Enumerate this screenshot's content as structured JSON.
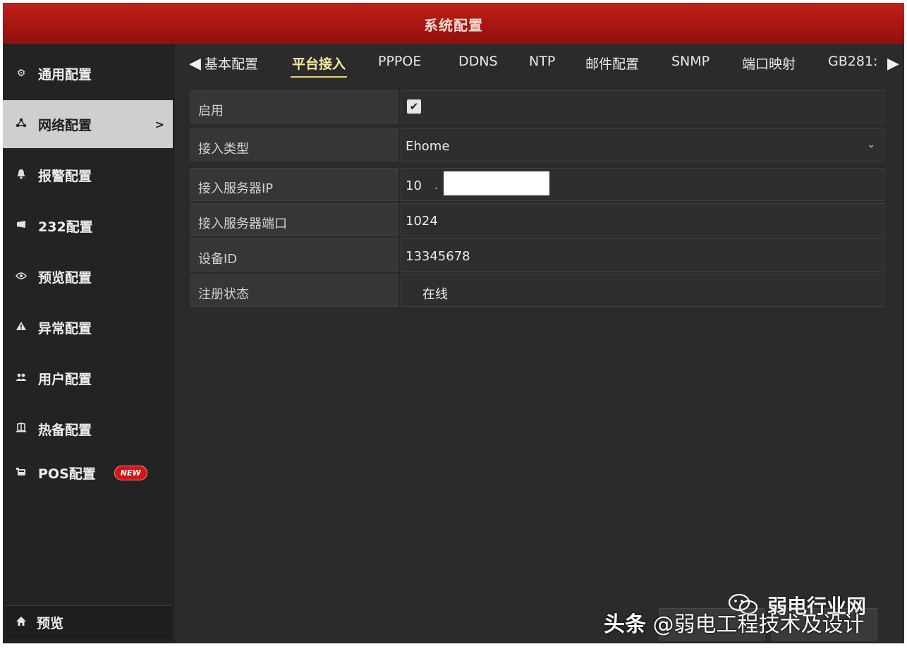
{
  "window": {
    "title": "系统配置"
  },
  "sidebar": {
    "items": [
      {
        "label": "通用配置",
        "icon": "gear-icon",
        "active": false
      },
      {
        "label": "网络配置",
        "icon": "network-icon",
        "active": true
      },
      {
        "label": "报警配置",
        "icon": "alarm-bell-icon",
        "active": false
      },
      {
        "label": "232配置",
        "icon": "serial-port-icon",
        "active": false
      },
      {
        "label": "预览配置",
        "icon": "eye-icon",
        "active": false
      },
      {
        "label": "异常配置",
        "icon": "warning-icon",
        "active": false
      },
      {
        "label": "用户配置",
        "icon": "users-icon",
        "active": false
      },
      {
        "label": "热备配置",
        "icon": "hot-spare-icon",
        "active": false
      },
      {
        "label": "POS配置",
        "icon": "pos-terminal-icon",
        "active": false,
        "badge": "NEW"
      }
    ],
    "active_arrow": ">",
    "preview": {
      "label": "预览",
      "icon": "home-icon"
    }
  },
  "tabs": {
    "items": [
      "基本配置",
      "平台接入",
      "PPPOE",
      "DDNS",
      "NTP",
      "邮件配置",
      "SNMP",
      "端口映射",
      "GB281:"
    ],
    "active": "平台接入"
  },
  "form": {
    "enable": {
      "label": "启用",
      "checked": true,
      "check_glyph": "✔"
    },
    "access_type": {
      "label": "接入类型",
      "value": "Ehome"
    },
    "server_ip": {
      "label": "接入服务器IP",
      "value": "10",
      "dot": "."
    },
    "server_port": {
      "label": "接入服务器端口",
      "value": "1024"
    },
    "device_id": {
      "label": "设备ID",
      "value": "13345678"
    },
    "register_status": {
      "label": "注册状态",
      "value": "在线"
    }
  },
  "bottom_buttons": [
    "",
    ""
  ],
  "watermark": {
    "platform": "头条",
    "author": "@弱电工程技术及设计",
    "overlay": "弱电行业网"
  },
  "colors": {
    "titlebar": "#a51510",
    "accent_tab": "#e8d26a",
    "badge": "#d31515",
    "panel": "#2b2b2b"
  }
}
